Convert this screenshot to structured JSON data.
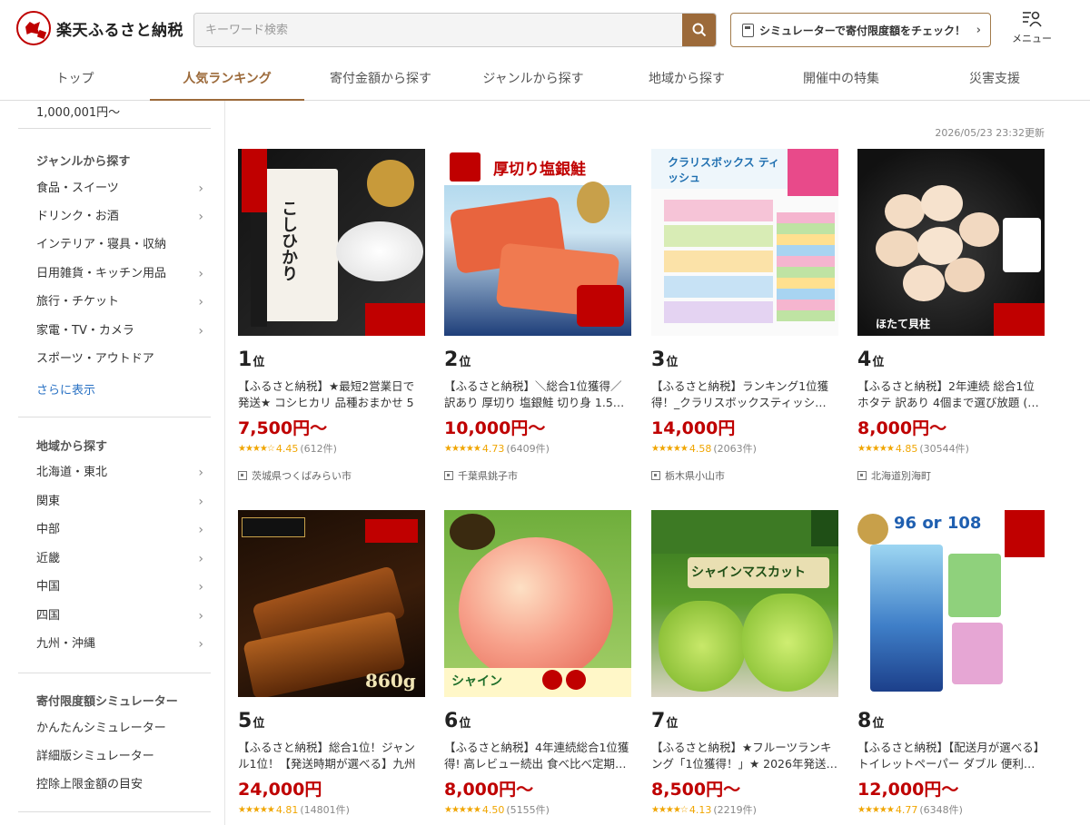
{
  "header": {
    "logo_text": "楽天ふるさと納税",
    "search_placeholder": "キーワード検索",
    "simulator_label": "シミュレーターで寄付限度額をチェック！",
    "menu_label": "メニュー"
  },
  "tabs": [
    {
      "label": "トップ",
      "active": false
    },
    {
      "label": "人気ランキング",
      "active": true
    },
    {
      "label": "寄付金額から探す",
      "active": false
    },
    {
      "label": "ジャンルから探す",
      "active": false
    },
    {
      "label": "地域から探す",
      "active": false
    },
    {
      "label": "開催中の特集",
      "active": false
    },
    {
      "label": "災害支援",
      "active": false
    }
  ],
  "sidebar": {
    "top_item": "1,000,001円～",
    "genre_heading": "ジャンルから探す",
    "genre_items": [
      "食品・スイーツ",
      "ドリンク・お酒",
      "インテリア・寝具・収納",
      "日用雑貨・キッチン用品",
      "旅行・チケット",
      "家電・TV・カメラ",
      "スポーツ・アウトドア"
    ],
    "more_label": "さらに表示",
    "region_heading": "地域から探す",
    "region_items": [
      "北海道・東北",
      "関東",
      "中部",
      "近畿",
      "中国",
      "四国",
      "九州・沖縄"
    ],
    "sim_heading": "寄付限度額シミュレーター",
    "sim_items": [
      "かんたんシミュレーター",
      "詳細版シミュレーター",
      "控除上限金額の目安"
    ]
  },
  "updated": "2026/05/23 23:32更新",
  "rank_suffix": "位",
  "products": [
    {
      "rank": "1",
      "title": "【ふるさと納税】★最短2営業日で発送★ コシヒカリ 品種おまかせ 5k…",
      "price": "7,500円～",
      "score": "4.45",
      "reviews": "(612件)",
      "stars": "★★★★☆",
      "location": "茨城県つくばみらい市",
      "thumb_text": "こしひかり"
    },
    {
      "rank": "2",
      "title": "【ふるさと納税】＼総合1位獲得／訳あり 厚切り 塩銀鮭 切り身 1.5…",
      "price": "10,000円～",
      "score": "4.73",
      "reviews": "(6409件)",
      "stars": "★★★★★",
      "location": "千葉県銚子市",
      "thumb_text": "厚切り塩銀鮭"
    },
    {
      "rank": "3",
      "title": "【ふるさと納税】ランキング1位獲得！_クラリスボックスティッシ…",
      "price": "14,000円",
      "score": "4.58",
      "reviews": "(2063件)",
      "stars": "★★★★★",
      "location": "栃木県小山市",
      "thumb_text": "クラリスボックス ティッシュ"
    },
    {
      "rank": "4",
      "title": "【ふるさと納税】2年連続 総合1位 ホタテ 訳あり 4個まで選び放題 (…",
      "price": "8,000円～",
      "score": "4.85",
      "reviews": "(30544件)",
      "stars": "★★★★★",
      "location": "北海道別海町",
      "thumb_text": "ほたて貝柱"
    },
    {
      "rank": "5",
      "title": "【ふるさと納税】総合1位！ジャンル1位！【発送時期が選べる】九州産…",
      "price": "24,000円",
      "score": "4.81",
      "reviews": "(14801件)",
      "stars": "★★★★★",
      "location": "",
      "thumb_text": "860g"
    },
    {
      "rank": "6",
      "title": "【ふるさと納税】4年連続総合1位獲得! 高レビュー続出 食べ比べ定期…",
      "price": "8,000円～",
      "score": "4.50",
      "reviews": "(5155件)",
      "stars": "★★★★★",
      "location": "",
      "thumb_text": "シャイン"
    },
    {
      "rank": "7",
      "title": "【ふるさと納税】★フルーツランキング「1位獲得！」★ 2026年発送…",
      "price": "8,500円～",
      "score": "4.13",
      "reviews": "(2219件)",
      "stars": "★★★★☆",
      "location": "",
      "thumb_text": "シャインマスカット"
    },
    {
      "rank": "8",
      "title": "【ふるさと納税】【配送月が選べる】トイレットペーパー ダブル 便利…",
      "price": "12,000円～",
      "score": "4.77",
      "reviews": "(6348件)",
      "stars": "★★★★★",
      "location": "",
      "thumb_text": "96 or 108"
    }
  ],
  "colors": {
    "accent": "#9c6a3a",
    "price": "#bf0000",
    "star": "#f0a500",
    "link": "#2a72c4"
  }
}
